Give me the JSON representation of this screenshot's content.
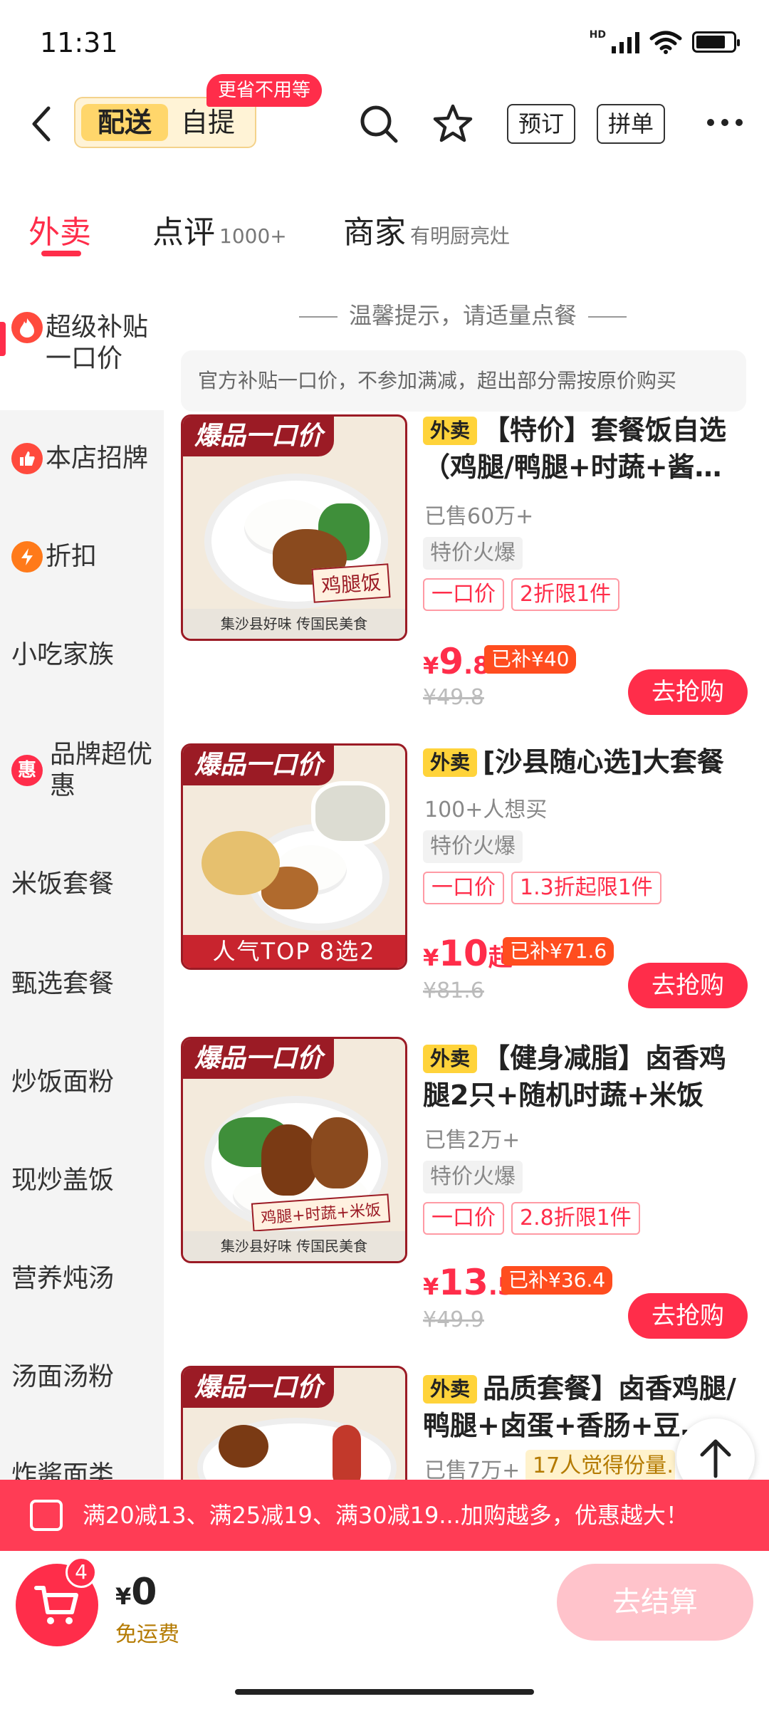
{
  "status": {
    "time": "11:31",
    "hd": "HD"
  },
  "header": {
    "mode_delivery": "配送",
    "mode_pickup": "自提",
    "pickup_tip": "更省不用等",
    "reserve": "预订",
    "group": "拼单"
  },
  "tabs": [
    {
      "label": "外卖",
      "extra": ""
    },
    {
      "label": "点评",
      "extra": "1000+"
    },
    {
      "label": "商家",
      "extra": "有明厨亮灶"
    }
  ],
  "sidebar": {
    "items": [
      {
        "label": "超级补贴\n一口价",
        "icon": "flame-icon",
        "color": "#ff4a3d"
      },
      {
        "label": "本店招牌",
        "icon": "thumb-icon",
        "color": "#ff4a3d"
      },
      {
        "label": "折扣",
        "icon": "discount-icon",
        "color": "#ff7a1a"
      },
      {
        "label": "小吃家族"
      },
      {
        "label": "品牌超优\n惠",
        "icon": "hui-icon",
        "glyph": "惠",
        "color": "#ff2d4a"
      },
      {
        "label": "米饭套餐"
      },
      {
        "label": "甄选套餐"
      },
      {
        "label": "炒饭面粉"
      },
      {
        "label": "现炒盖饭"
      },
      {
        "label": "营养炖汤"
      },
      {
        "label": "汤面汤粉"
      },
      {
        "label": "炸酱面类"
      }
    ]
  },
  "notice": "温馨提示，请适量点餐",
  "subsidy_note": "官方补贴一口价，不参加满减，超出部分需按原价购买",
  "image_badge": "爆品一口价",
  "delivery_tag": "外卖",
  "products": [
    {
      "title": "【特价】套餐饭自选（鸡腿/鸭腿+时蔬+酱…",
      "img_label": "鸡腿饭",
      "img_footer": "集沙县好味 传国民美食",
      "sold": "已售60万+",
      "tag": "特价火爆",
      "chips": [
        "一口价",
        "2折限1件"
      ],
      "price_int": "9",
      "price_dec": ".8",
      "price_suffix": "",
      "subsidy": "已补¥40",
      "orig": "¥49.8",
      "buy": "去抢购"
    },
    {
      "title": "[沙县随心选]大套餐",
      "img_label": "",
      "img_footer": "人气TOP 8选2",
      "sold": "100+人想买",
      "tag": "特价火爆",
      "chips": [
        "一口价",
        "1.3折起限1件"
      ],
      "price_int": "10",
      "price_dec": "",
      "price_suffix": "起",
      "subsidy": "已补¥71.6",
      "orig": "¥81.6",
      "buy": "去抢购"
    },
    {
      "title": "【健身减脂】卤香鸡腿2只+随机时蔬+米饭",
      "img_label": "鸡腿+时蔬+米饭",
      "img_footer": "集沙县好味 传国民美食",
      "sold": "已售2万+",
      "tag": "特价火爆",
      "chips": [
        "一口价",
        "2.8折限1件"
      ],
      "price_int": "13",
      "price_dec": ".5",
      "price_suffix": "",
      "subsidy": "已补¥36.4",
      "orig": "¥49.9",
      "buy": "去抢购"
    },
    {
      "title": "品质套餐】卤香鸡腿/鸭腿+卤蛋+香肠+豆…",
      "sold": "已售7万+",
      "tag": "17人觉得份量…"
    }
  ],
  "promo": "满20减13、满25减19、满30减19...加购越多，优惠越大！",
  "cart": {
    "count": "4",
    "currency": "¥",
    "total": "0",
    "fee": "免运费",
    "checkout": "去结算"
  },
  "colors": {
    "accent": "#ff2d4a",
    "tag_yellow": "#ffd33a",
    "subsidy": "#ff4d1f"
  }
}
